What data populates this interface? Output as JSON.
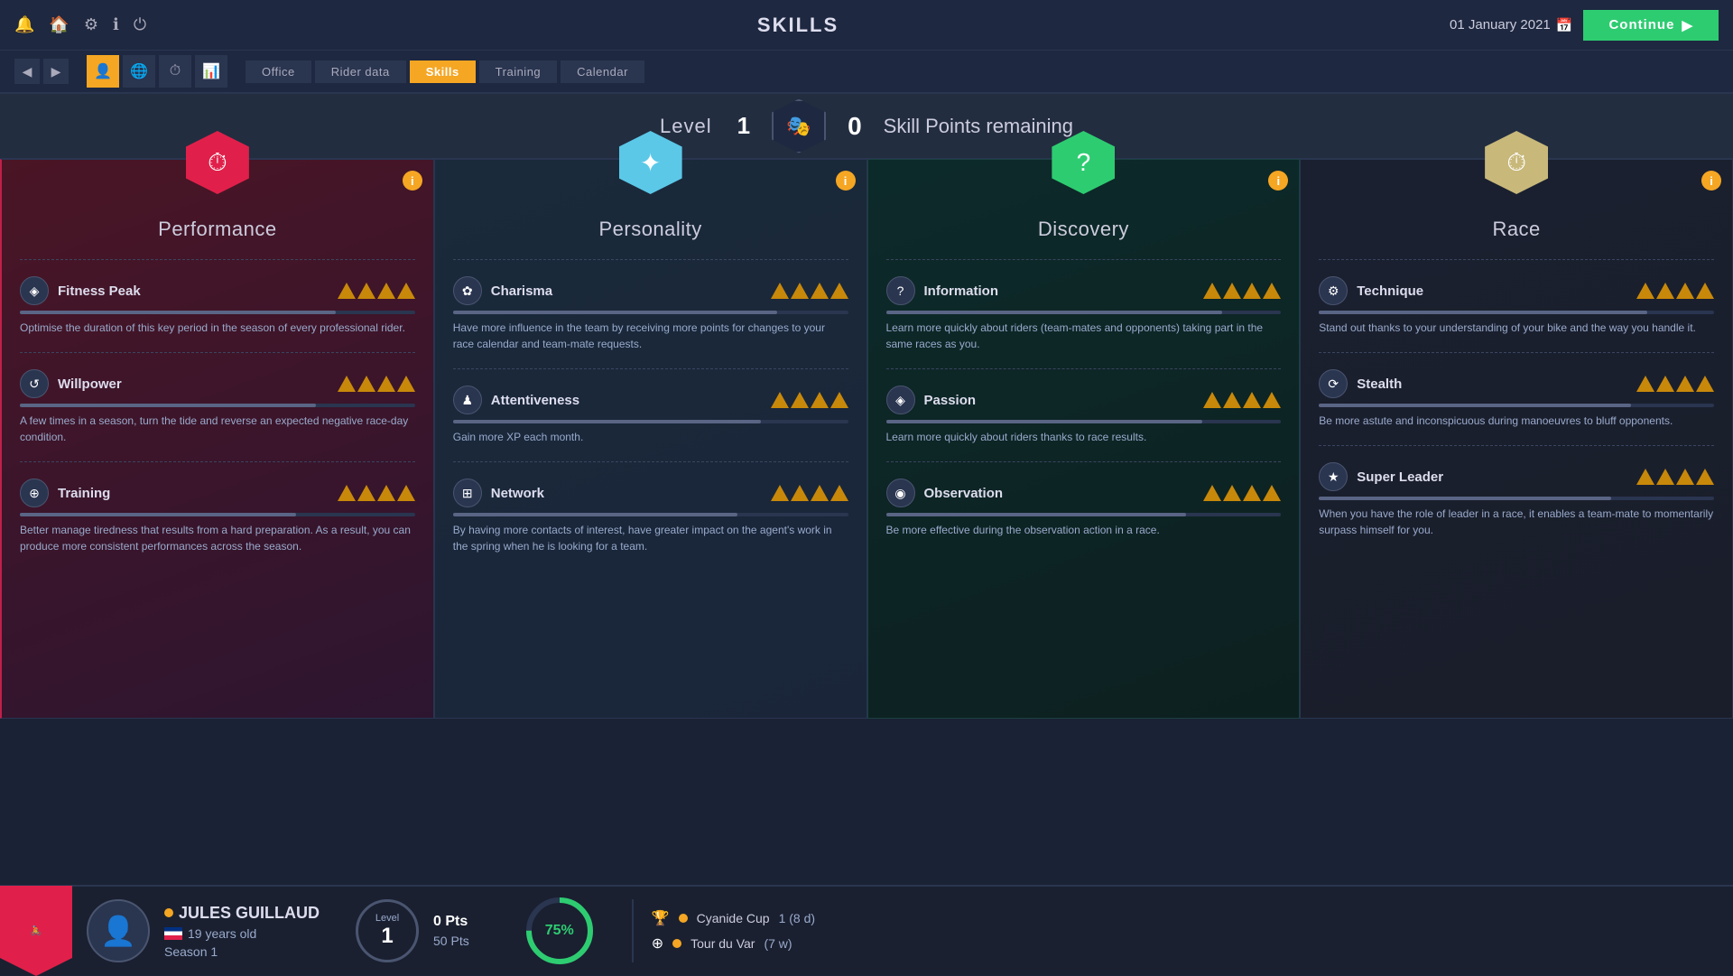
{
  "topbar": {
    "title": "SKILLS",
    "date": "01 January 2021",
    "continue_label": "Continue"
  },
  "nav": {
    "tabs": [
      "Office",
      "Rider data",
      "Skills",
      "Training",
      "Calendar"
    ],
    "active_tab": "Skills"
  },
  "level_bar": {
    "level_label": "Level",
    "level_value": "1",
    "skill_points_label": "Skill Points remaining",
    "skill_points_value": "0"
  },
  "cards": [
    {
      "id": "performance",
      "title": "Performance",
      "icon": "⏱",
      "hex_class": "hex-performance",
      "card_class": "performance",
      "skills": [
        {
          "name": "Fitness Peak",
          "icon": "◈",
          "stars": 4,
          "bar_pct": 80,
          "desc": "Optimise the duration of this key period in the season of every professional rider."
        },
        {
          "name": "Willpower",
          "icon": "↺",
          "stars": 4,
          "bar_pct": 75,
          "desc": "A few times in a season, turn the tide and reverse an expected negative race-day condition."
        },
        {
          "name": "Training",
          "icon": "⊕",
          "stars": 4,
          "bar_pct": 70,
          "desc": "Better manage tiredness that results from a hard preparation. As a result, you can produce more consistent performances across the season."
        }
      ]
    },
    {
      "id": "personality",
      "title": "Personality",
      "icon": "✦",
      "hex_class": "hex-personality",
      "card_class": "personality",
      "skills": [
        {
          "name": "Charisma",
          "icon": "✿",
          "stars": 4,
          "bar_pct": 82,
          "desc": "Have more influence in the team by receiving more points for changes to your race calendar and team-mate requests."
        },
        {
          "name": "Attentiveness",
          "icon": "♟",
          "stars": 4,
          "bar_pct": 78,
          "desc": "Gain more XP each month."
        },
        {
          "name": "Network",
          "icon": "⊞",
          "stars": 4,
          "bar_pct": 72,
          "desc": "By having more contacts of interest, have greater impact on the agent's work in the spring when he is looking for a team."
        }
      ]
    },
    {
      "id": "discovery",
      "title": "Discovery",
      "icon": "?",
      "hex_class": "hex-discovery",
      "card_class": "discovery",
      "skills": [
        {
          "name": "Information",
          "icon": "?",
          "stars": 4,
          "bar_pct": 85,
          "desc": "Learn more quickly about riders (team-mates and opponents) taking part in the same races as you."
        },
        {
          "name": "Passion",
          "icon": "◈",
          "stars": 4,
          "bar_pct": 80,
          "desc": "Learn more quickly about riders thanks to race results."
        },
        {
          "name": "Observation",
          "icon": "◉",
          "stars": 4,
          "bar_pct": 76,
          "desc": "Be more effective during the observation action in a race."
        }
      ]
    },
    {
      "id": "race",
      "title": "Race",
      "icon": "⏱",
      "hex_class": "hex-race",
      "card_class": "race",
      "skills": [
        {
          "name": "Technique",
          "icon": "⚙",
          "stars": 4,
          "bar_pct": 83,
          "desc": "Stand out thanks to your understanding of your bike and the way you handle it."
        },
        {
          "name": "Stealth",
          "icon": "⟳",
          "stars": 4,
          "bar_pct": 79,
          "desc": "Be more astute and inconspicuous during manoeuvres to bluff opponents."
        },
        {
          "name": "Super Leader",
          "icon": "★",
          "stars": 4,
          "bar_pct": 74,
          "desc": "When you have the role of leader in a race, it enables a team-mate to momentarily surpass himself for you."
        }
      ]
    }
  ],
  "bottom": {
    "rider_name": "JULES GUILLAUD",
    "rider_age": "19 years old",
    "rider_season": "Season 1",
    "level_label": "Level",
    "level_value": "1",
    "pts_current": "0 Pts",
    "pts_total": "50 Pts",
    "progress_pct": "75%",
    "races": [
      {
        "icon": "🏆",
        "name": "Cyanide Cup",
        "time": "1 (8 d)"
      },
      {
        "icon": "⊕",
        "name": "Tour du Var",
        "time": "(7 w)"
      }
    ]
  }
}
